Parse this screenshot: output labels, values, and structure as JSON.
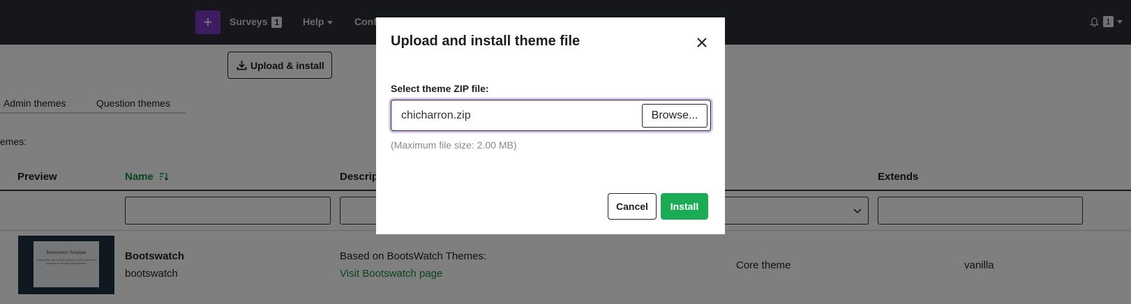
{
  "navbar": {
    "plus_icon": "plus-icon",
    "surveys_label": "Surveys",
    "surveys_count": "1",
    "help_label": "Help",
    "config_label": "Confi",
    "notifications_count": "1"
  },
  "toolbar": {
    "upload_label": "Upload & install"
  },
  "tabs": [
    {
      "label": "Admin themes"
    },
    {
      "label": "Question themes"
    }
  ],
  "section_label": "emes:",
  "table": {
    "headers": {
      "preview": "Preview",
      "name": "Name",
      "description": "Descrip",
      "extends": "Extends"
    },
    "rows": [
      {
        "preview_title": "Bootswatch Template",
        "preview_sub": "A template with custom options to show what it's possible to do with new engines.",
        "name": "Bootswatch",
        "name_sub": "bootswatch",
        "description": "Based on BootsWatch Themes:",
        "link": "Visit Bootswatch page",
        "type": "Core theme",
        "extends": "vanilla"
      }
    ]
  },
  "modal": {
    "title": "Upload and install theme file",
    "field_label": "Select theme ZIP file:",
    "file_name": "chicharron.zip",
    "browse_label": "Browse...",
    "hint": "(Maximum file size: 2.00 MB)",
    "cancel_label": "Cancel",
    "install_label": "Install"
  },
  "colors": {
    "navbar": "#2a2f36",
    "accent_purple": "#7a38c4",
    "success_green": "#1bab55",
    "link_green": "#14863b"
  }
}
